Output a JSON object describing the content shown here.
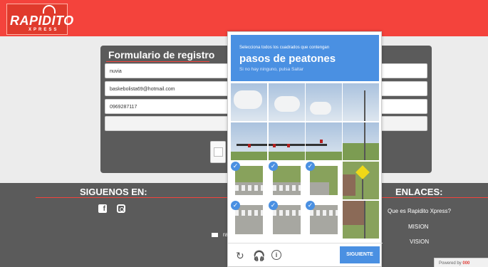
{
  "brand": {
    "logo_text": "RAPIDITO",
    "logo_sub": "XPRESS"
  },
  "form": {
    "title": "Formulario de registro",
    "fields": [
      {
        "value": "nuvia"
      },
      {
        "value": "baskebolista69@hotmail.com"
      },
      {
        "value": "0969287117"
      },
      {
        "value": ""
      }
    ]
  },
  "footer": {
    "social_heading": "SIGUENOS EN:",
    "links_heading": "ENLACES:",
    "social_icons": [
      "facebook-icon",
      "instagram-icon"
    ],
    "mail_text": "ra",
    "links": [
      "Que es Rapidito Xpress?",
      "MISION",
      "VISION"
    ]
  },
  "powered": {
    "prefix": "Powered by",
    "brand": "000"
  },
  "captcha": {
    "instruction": "Selecciona todos los cuadrados que contengan",
    "target": "pasos de peatones",
    "hint": "Si no hay ninguno, pulsa Saltar",
    "selected_tiles": [
      8,
      9,
      10,
      12,
      13,
      14
    ],
    "next_label": "SIGUIENTE",
    "icons": [
      "reload-icon",
      "audio-icon",
      "info-icon"
    ],
    "accent": "#4a90e2"
  },
  "colors": {
    "brand_red": "#f4433c",
    "panel_gray": "#5b5b5b"
  }
}
